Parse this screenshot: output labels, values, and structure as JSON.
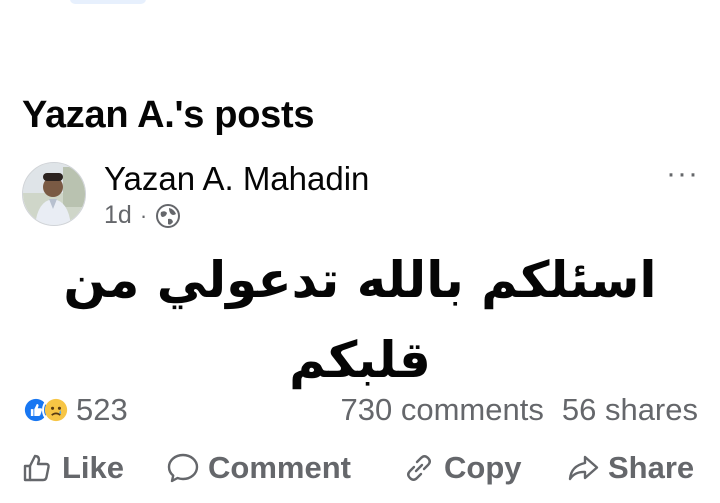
{
  "section": {
    "title": "Yazan A.'s posts"
  },
  "post": {
    "author": "Yazan A. Mahadin",
    "time": "1d",
    "separator": "·",
    "privacy_icon": "globe-icon",
    "more_icon": "more-options-icon",
    "more_label": "···",
    "text": "اسئلكم بالله تدعولي من قلبكم"
  },
  "stats": {
    "reaction_icons": [
      "like-reaction-icon",
      "sad-reaction-icon"
    ],
    "reactions_count": "523",
    "comments": "730 comments",
    "shares": "56 shares"
  },
  "actions": {
    "like": "Like",
    "comment": "Comment",
    "copy": "Copy",
    "share": "Share"
  },
  "colors": {
    "text_primary": "#050505",
    "text_secondary": "#65676b",
    "like_blue": "#1877f2",
    "sad_yellow": "#f7c545"
  }
}
